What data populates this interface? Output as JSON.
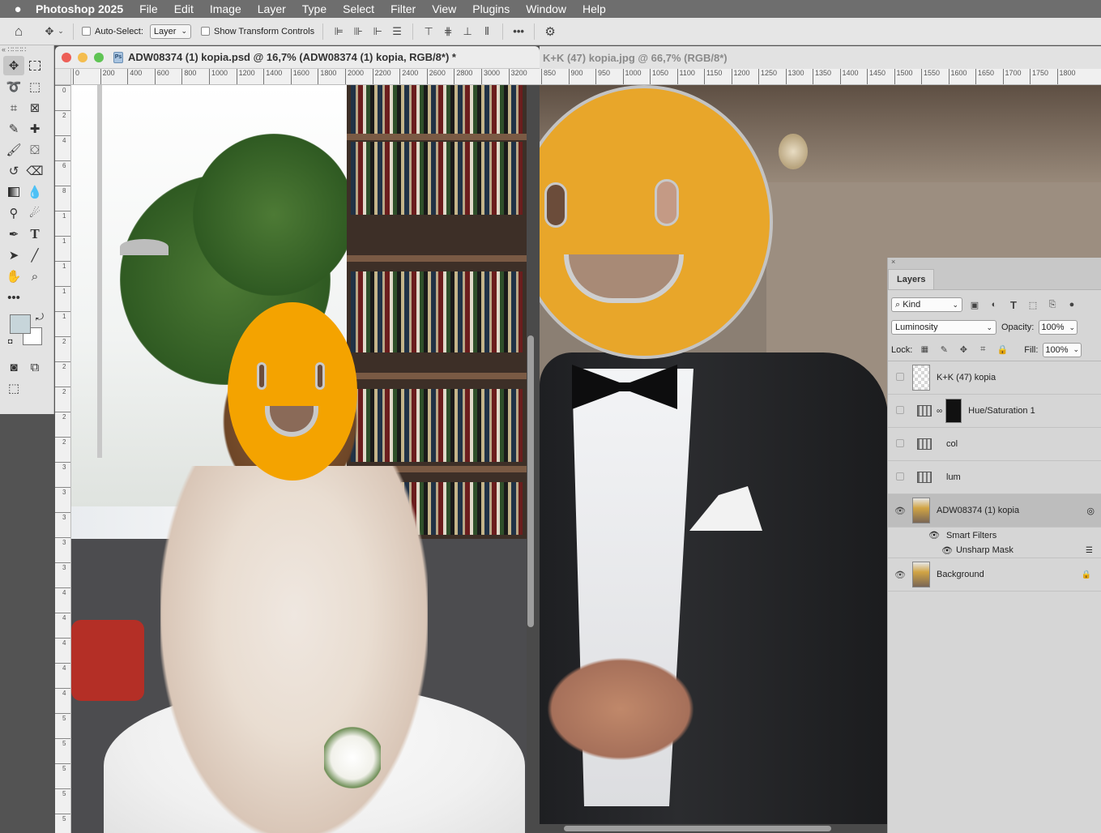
{
  "menubar": {
    "apple": "",
    "app": "Photoshop 2025",
    "items": [
      "File",
      "Edit",
      "Image",
      "Layer",
      "Type",
      "Select",
      "Filter",
      "View",
      "Plugins",
      "Window",
      "Help"
    ]
  },
  "options": {
    "auto_select_label": "Auto-Select:",
    "auto_select_value": "Layer",
    "show_transform_label": "Show Transform Controls"
  },
  "doc1": {
    "title": "ADW08374 (1) kopia.psd @ 16,7% (ADW08374 (1) kopia, RGB/8*) *",
    "ruler_ticks": [
      "0",
      "200",
      "400",
      "600",
      "800",
      "1000",
      "1200",
      "1400",
      "1600",
      "1800",
      "2000",
      "2200",
      "2400",
      "2600",
      "2800",
      "3000",
      "3200"
    ],
    "vruler_ticks": [
      "0",
      "2",
      "4",
      "6",
      "8",
      "1",
      "1",
      "1",
      "1",
      "1",
      "2",
      "2",
      "2",
      "2",
      "2",
      "3",
      "3",
      "3",
      "3",
      "3",
      "4",
      "4",
      "4",
      "4",
      "4",
      "5",
      "5",
      "5",
      "5",
      "5"
    ]
  },
  "doc2": {
    "title": "K+K (47) kopia.jpg @ 66,7% (RGB/8*)",
    "ruler_ticks": [
      "850",
      "900",
      "950",
      "1000",
      "1050",
      "1100",
      "1150",
      "1200",
      "1250",
      "1300",
      "1350",
      "1400",
      "1450",
      "1500",
      "1550",
      "1600",
      "1650",
      "1700",
      "1750",
      "1800"
    ]
  },
  "layers_panel": {
    "tab": "Layers",
    "filter_kind": "Kind",
    "blend_mode": "Luminosity",
    "opacity_label": "Opacity:",
    "opacity_value": "100%",
    "lock_label": "Lock:",
    "fill_label": "Fill:",
    "fill_value": "100%",
    "layers": [
      {
        "name": "K+K (47) kopia"
      },
      {
        "name": "Hue/Saturation 1"
      },
      {
        "name": "col"
      },
      {
        "name": "lum"
      },
      {
        "name": "ADW08374 (1) kopia"
      },
      {
        "name": "Background"
      }
    ],
    "smart_filters_label": "Smart Filters",
    "unsharp_mask_label": "Unsharp Mask"
  },
  "colors": {
    "smiley": "#f4a300",
    "foreground": "#c7d5da",
    "background": "#ffffff"
  }
}
